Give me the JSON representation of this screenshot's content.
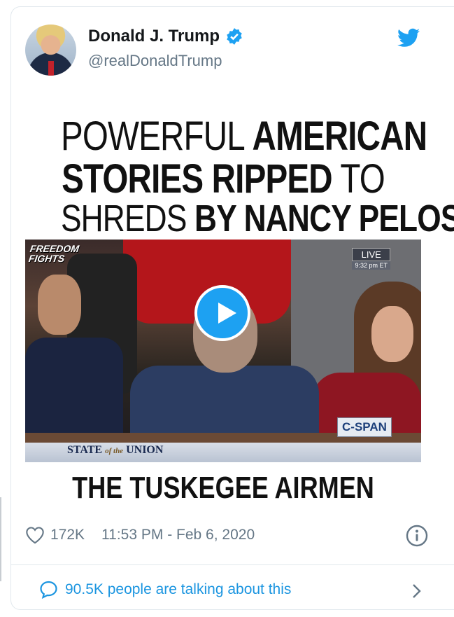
{
  "tweet": {
    "author_name": "Donald J. Trump",
    "author_handle": "@realDonaldTrump",
    "media": {
      "headline_line1_light": "POWERFUL ",
      "headline_line1_bold": "AMERICAN",
      "headline_line2_bold": "STORIES RIPPED",
      "headline_line2_light": " TO",
      "headline_line3_light": "SHREDS ",
      "headline_line3_bold": "BY NANCY PELOSI",
      "logo_line1": "FREEDOM",
      "logo_line2": "FIGHTS",
      "live_label": "LIVE",
      "live_time": "9:32 pm ET",
      "network_badge": "C-SPAN",
      "banner_state": "STATE ",
      "banner_the": "of the",
      "banner_union": " UNION",
      "caption": "THE TUSKEGEE AIRMEN"
    },
    "likes": "172K",
    "timestamp": "11:53 PM - Feb 6, 2020",
    "talking": "90.5K people are talking about this"
  },
  "colors": {
    "accent": "#1da1f2",
    "link": "#1b95e0",
    "muted": "#657786"
  },
  "icons": [
    "verified-icon",
    "twitter-bird-icon",
    "play-icon",
    "heart-icon",
    "info-icon",
    "speech-bubble-icon",
    "chevron-right-icon"
  ]
}
